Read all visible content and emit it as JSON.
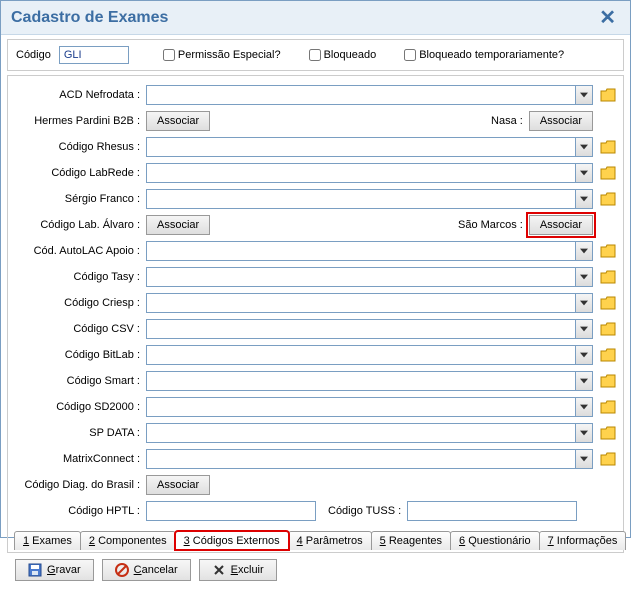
{
  "title": "Cadastro de Exames",
  "header": {
    "codigo_label": "Código",
    "codigo_value": "GLI",
    "check_permissao": "Permissão Especial?",
    "check_bloqueado": "Bloqueado",
    "check_bloqueado_temp": "Bloqueado temporariamente?"
  },
  "labels": {
    "acd_nefrodata": "ACD Nefrodata :",
    "hermes_b2b": "Hermes Pardini B2B :",
    "nasa": "Nasa :",
    "codigo_rhesus": "Código Rhesus :",
    "codigo_labrede": "Código LabRede :",
    "sergio_franco": "Sérgio Franco :",
    "codigo_lab_alvaro": "Código Lab. Álvaro :",
    "sao_marcos": "São Marcos :",
    "cod_autolac": "Cód. AutoLAC Apoio :",
    "codigo_tasy": "Código Tasy :",
    "codigo_criesp": "Código Criesp :",
    "codigo_csv": "Código CSV :",
    "codigo_bitlab": "Código BitLab :",
    "codigo_smart": "Código Smart :",
    "codigo_sd2000": "Código SD2000 :",
    "sp_data": "SP DATA :",
    "matrixconnect": "MatrixConnect :",
    "codigo_diag_brasil": "Código Diag. do Brasil :",
    "codigo_hptl": "Código HPTL :",
    "codigo_tuss": "Código TUSS :"
  },
  "buttons": {
    "associar": "Associar",
    "gravar": "Gravar",
    "cancelar": "Cancelar",
    "excluir": "Excluir"
  },
  "tabs": [
    "1 Exames",
    "2 Componentes",
    "3 Códigos Externos",
    "4 Parâmetros",
    "5 Reagentes",
    "6 Questionário",
    "7 Informações"
  ],
  "tab_underline_idx": 0,
  "active_tab": 2
}
